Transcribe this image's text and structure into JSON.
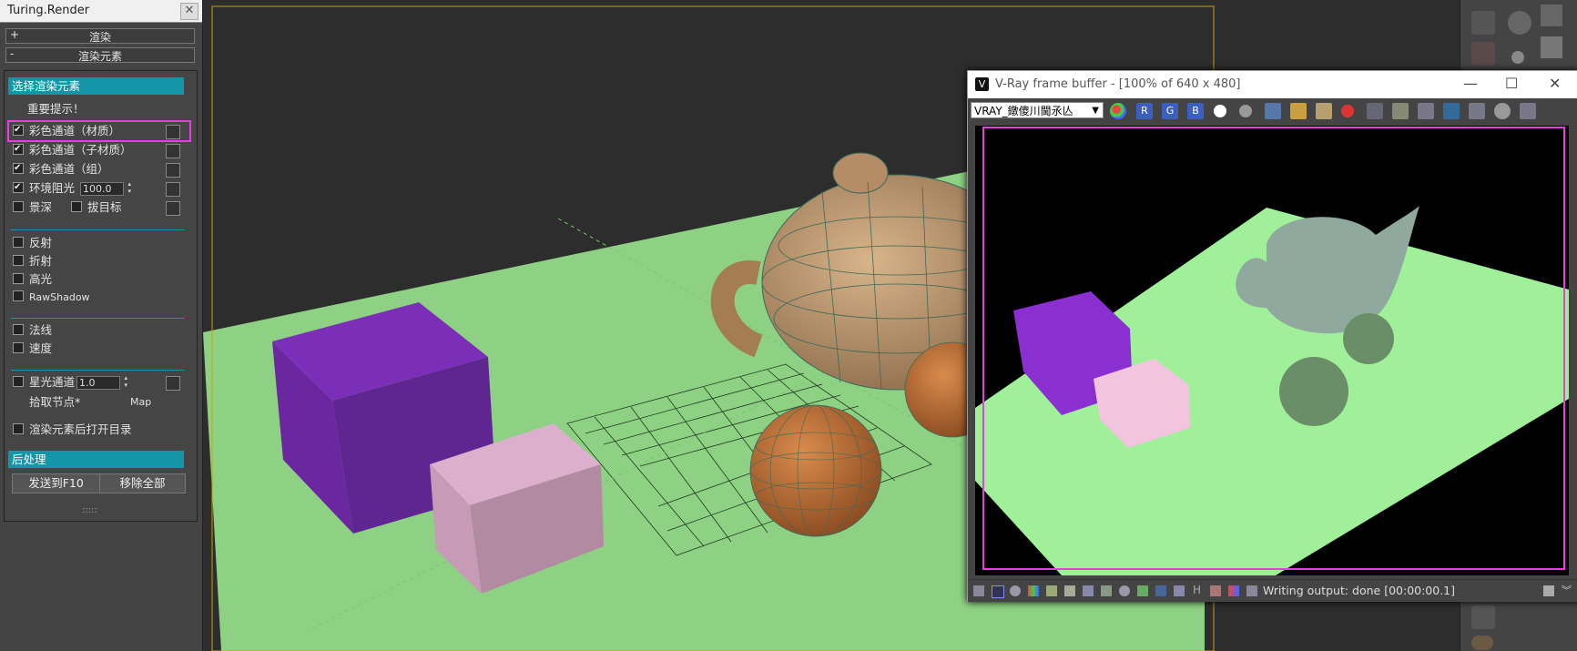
{
  "left_panel": {
    "title": "Turing.Render",
    "close": "✕",
    "rollouts": [
      {
        "sign": "+",
        "label": "渲染"
      },
      {
        "sign": "-",
        "label": "渲染元素"
      }
    ],
    "section_select": "选择渲染元素",
    "hint": "重要提示！",
    "items": [
      {
        "label": "彩色通道（材质）",
        "checked": true
      },
      {
        "label": "彩色通道（子材质）",
        "checked": true
      },
      {
        "label": "彩色通道（组）",
        "checked": true
      },
      {
        "label": "环境阻光",
        "checked": true,
        "spinner": "100.0"
      }
    ],
    "dof_label": "景深",
    "pick_target_label": "拔目标",
    "group2": [
      "反射",
      "折射",
      "高光",
      "RawShadow"
    ],
    "group3": [
      "法线",
      "速度"
    ],
    "star_label": "星光通道",
    "star_value": "1.0",
    "pick_node_label": "拾取节点*",
    "map_label": "Map",
    "open_dir_label": "渲染元素后打开目录",
    "section_post": "后处理",
    "send_button": "发送到F10",
    "remove_all_button": "移除全部",
    "grip": ":::::"
  },
  "vfb": {
    "title": "V-Ray frame buffer - [100% of 640 x 480]",
    "minimize": "—",
    "maximize": "☐",
    "close": "✕",
    "channel_select": "VRAY_鐓傻川閫氶亾",
    "channels": [
      "R",
      "G",
      "B"
    ],
    "status": "Writing output: done [00:00:00.1]",
    "status_h": "H"
  },
  "colors": {
    "accent": "#1595a8",
    "highlight": "#e83ee0",
    "floor": "#8ed184",
    "render_floor": "#a0f09a",
    "cube_purple": "#7b2fb8",
    "cube_pink": "#d9a8c4"
  }
}
